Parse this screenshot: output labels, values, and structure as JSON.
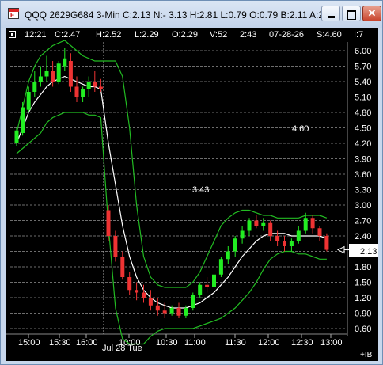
{
  "window": {
    "title": "QQQ 2629G684 3-Min C:2.13 N:- 3.13 H:2.81 L:0.79 O:0.79 B:2.11 A:2.13",
    "app_icon_text": "E",
    "close_glyph": "✕",
    "icons": {
      "app": "app-icon",
      "minimize": "minimize-icon",
      "maximize": "maximize-icon",
      "close": "close-icon"
    }
  },
  "infobar": {
    "time": "12:21",
    "close": "C:2.47",
    "high": "H:2.52",
    "low": "L:2.29",
    "open": "O:2.29",
    "volume": "V:52",
    "time2": "2:43",
    "date": "07-28-26",
    "strike": "S:4.60",
    "index": "I:7"
  },
  "chart": {
    "last_price": "2.13",
    "label_high": "4.60",
    "label_mid": "3.43",
    "date_label": "Jul 28 Tue",
    "corner_label": "+IB",
    "colors": {
      "background": "#000000",
      "up": "#22ee22",
      "down": "#ee3333",
      "band": "#22bb22",
      "average": "#ffffff",
      "grid": "#6e6e6e",
      "text": "#ffffff"
    }
  },
  "chart_data": {
    "type": "candlestick",
    "y_ticks": [
      "6.00",
      "5.70",
      "5.40",
      "5.10",
      "4.80",
      "4.50",
      "4.20",
      "3.90",
      "3.60",
      "3.30",
      "3.00",
      "2.70",
      "2.40",
      "2.10",
      "1.80",
      "1.50",
      "1.20",
      "0.90",
      "0.60"
    ],
    "x_ticks": [
      "15:00",
      "15:30",
      "16:00",
      "10:00",
      "10:30",
      "11:00",
      "11:30",
      "12:00",
      "12:30",
      "13:00"
    ],
    "ylim": [
      0.6,
      6.0
    ],
    "candles": [
      [
        4.2,
        4.5,
        4.15,
        4.45
      ],
      [
        4.4,
        5.0,
        4.35,
        4.9
      ],
      [
        4.85,
        5.3,
        4.8,
        5.2
      ],
      [
        5.2,
        5.6,
        5.1,
        5.4
      ],
      [
        5.4,
        5.7,
        5.3,
        5.5
      ],
      [
        5.5,
        5.9,
        5.4,
        5.6
      ],
      [
        5.6,
        5.8,
        5.3,
        5.4
      ],
      [
        5.4,
        5.8,
        5.35,
        5.75
      ],
      [
        5.7,
        6.05,
        5.6,
        5.85
      ],
      [
        5.8,
        5.95,
        5.2,
        5.3
      ],
      [
        5.3,
        5.5,
        5.0,
        5.1
      ],
      [
        5.1,
        5.3,
        5.0,
        5.25
      ],
      [
        5.25,
        5.5,
        5.1,
        5.4
      ],
      [
        5.4,
        5.6,
        5.2,
        5.3
      ],
      [
        5.3,
        5.45,
        5.2,
        5.25
      ],
      [
        2.9,
        3.0,
        2.3,
        2.4
      ],
      [
        2.4,
        2.5,
        1.9,
        2.0
      ],
      [
        2.0,
        2.1,
        1.55,
        1.6
      ],
      [
        1.6,
        1.7,
        1.25,
        1.35
      ],
      [
        1.35,
        1.5,
        1.15,
        1.3
      ],
      [
        1.3,
        1.45,
        1.1,
        1.2
      ],
      [
        1.2,
        1.35,
        0.95,
        1.05
      ],
      [
        1.05,
        1.2,
        0.85,
        0.95
      ],
      [
        0.95,
        1.1,
        0.8,
        0.9
      ],
      [
        0.9,
        1.05,
        0.85,
        1.0
      ],
      [
        1.0,
        1.1,
        0.8,
        0.85
      ],
      [
        0.85,
        1.05,
        0.8,
        1.0
      ],
      [
        1.0,
        1.3,
        0.95,
        1.25
      ],
      [
        1.25,
        1.5,
        1.2,
        1.45
      ],
      [
        1.45,
        1.6,
        1.3,
        1.4
      ],
      [
        1.4,
        1.7,
        1.35,
        1.65
      ],
      [
        1.65,
        2.0,
        1.6,
        1.95
      ],
      [
        1.95,
        2.2,
        1.85,
        2.1
      ],
      [
        2.1,
        2.4,
        2.0,
        2.35
      ],
      [
        2.35,
        2.6,
        2.25,
        2.5
      ],
      [
        2.5,
        2.75,
        2.4,
        2.7
      ],
      [
        2.7,
        2.8,
        2.55,
        2.6
      ],
      [
        2.6,
        2.75,
        2.5,
        2.65
      ],
      [
        2.65,
        2.7,
        2.3,
        2.4
      ],
      [
        2.4,
        2.5,
        2.2,
        2.3
      ],
      [
        2.3,
        2.4,
        2.1,
        2.2
      ],
      [
        2.2,
        2.35,
        2.1,
        2.3
      ],
      [
        2.3,
        2.6,
        2.25,
        2.5
      ],
      [
        2.5,
        2.85,
        2.45,
        2.75
      ],
      [
        2.75,
        2.8,
        2.45,
        2.55
      ],
      [
        2.55,
        2.6,
        2.3,
        2.4
      ],
      [
        2.4,
        2.45,
        2.1,
        2.13
      ]
    ],
    "average": [
      4.2,
      4.5,
      4.8,
      5.0,
      5.15,
      5.3,
      5.4,
      5.45,
      5.5,
      5.45,
      5.4,
      5.35,
      5.3,
      5.3,
      5.25,
      4.2,
      3.4,
      2.6,
      2.0,
      1.6,
      1.35,
      1.2,
      1.1,
      1.05,
      1.0,
      1.0,
      1.0,
      1.05,
      1.1,
      1.2,
      1.3,
      1.45,
      1.6,
      1.8,
      2.0,
      2.15,
      2.3,
      2.4,
      2.45,
      2.45,
      2.45,
      2.4,
      2.4,
      2.4,
      2.4,
      2.4,
      2.35
    ],
    "upper": [
      4.4,
      4.9,
      5.4,
      5.7,
      5.9,
      6.0,
      6.1,
      6.15,
      6.2,
      6.1,
      6.0,
      5.9,
      5.85,
      5.8,
      5.8,
      5.8,
      5.8,
      5.5,
      4.5,
      3.0,
      2.0,
      1.6,
      1.45,
      1.4,
      1.4,
      1.4,
      1.4,
      1.5,
      1.7,
      2.0,
      2.3,
      2.6,
      2.75,
      2.85,
      2.9,
      2.9,
      2.85,
      2.8,
      2.8,
      2.75,
      2.75,
      2.75,
      2.75,
      2.8,
      2.8,
      2.8,
      2.75
    ],
    "lower": [
      4.0,
      4.1,
      4.2,
      4.3,
      4.4,
      4.6,
      4.7,
      4.75,
      4.8,
      4.8,
      4.8,
      4.8,
      4.75,
      4.75,
      4.7,
      2.6,
      1.0,
      0.4,
      0.2,
      0.2,
      0.3,
      0.45,
      0.55,
      0.6,
      0.6,
      0.6,
      0.6,
      0.6,
      0.65,
      0.7,
      0.75,
      0.8,
      0.9,
      1.0,
      1.15,
      1.3,
      1.5,
      1.75,
      1.95,
      2.05,
      2.1,
      2.1,
      2.05,
      2.05,
      2.0,
      1.95,
      1.95
    ]
  }
}
